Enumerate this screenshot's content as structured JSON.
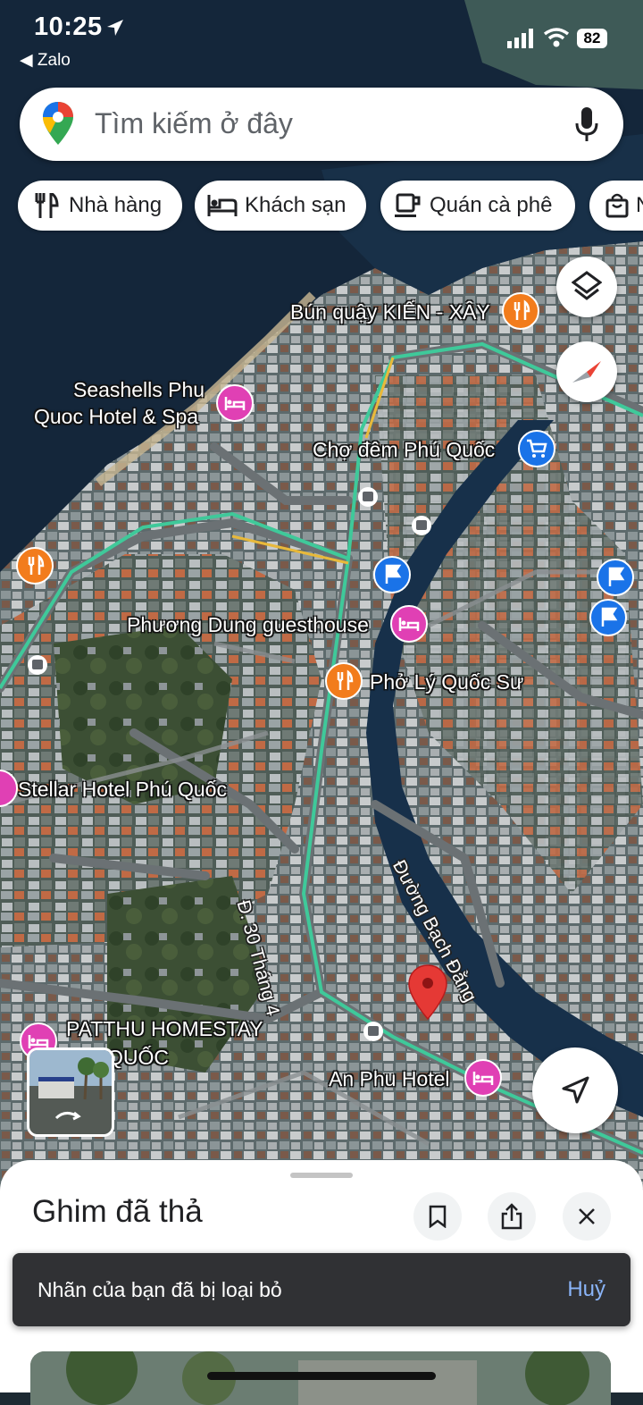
{
  "status_bar": {
    "time": "10:25",
    "back_app": "◀ Zalo",
    "battery": "82"
  },
  "search": {
    "placeholder": "Tìm kiếm ở đây"
  },
  "chips": [
    {
      "label": "Nhà hàng",
      "icon": "fork-knife-icon"
    },
    {
      "label": "Khách sạn",
      "icon": "bed-icon"
    },
    {
      "label": "Quán cà phê",
      "icon": "coffee-cup-icon"
    },
    {
      "label": "N",
      "icon": "shopping-bag-icon"
    }
  ],
  "map": {
    "places": [
      {
        "name": "Bún quậy KIẾN - XÂY",
        "category": "restaurant"
      },
      {
        "name": "Seashells Phu",
        "category": "hotel"
      },
      {
        "name": "Quoc Hotel & Spa",
        "category": "hotel"
      },
      {
        "name": "Chợ đêm Phú Quốc",
        "category": "shopping"
      },
      {
        "name": "Phương Dung guesthouse",
        "category": "hotel"
      },
      {
        "name": "Phở Lý Quốc Sư",
        "category": "restaurant"
      },
      {
        "name": "Stellar Hotel Phú Quốc",
        "category": "hotel"
      },
      {
        "name": "PATTHU HOMESTAY",
        "category": "hotel"
      },
      {
        "name": "QUỐC",
        "category": "hotel"
      },
      {
        "name": "An Phu Hotel",
        "category": "hotel"
      }
    ],
    "streets": {
      "street_1": "Đ. 30 Tháng 4",
      "street_2": "Đường Bạch Đằng"
    },
    "colors": {
      "water": "#15273a",
      "road": "#6b7174",
      "route": "#3fc99a",
      "hotel_pin": "#e040b4",
      "food_pin": "#f27c1c",
      "shop_pin": "#1a73e8",
      "dropped_pin": "#e53935"
    }
  },
  "sheet": {
    "title": "Ghim đã thả"
  },
  "toast": {
    "message": "Nhãn của bạn đã bị loại bỏ",
    "action": "Huỷ"
  }
}
